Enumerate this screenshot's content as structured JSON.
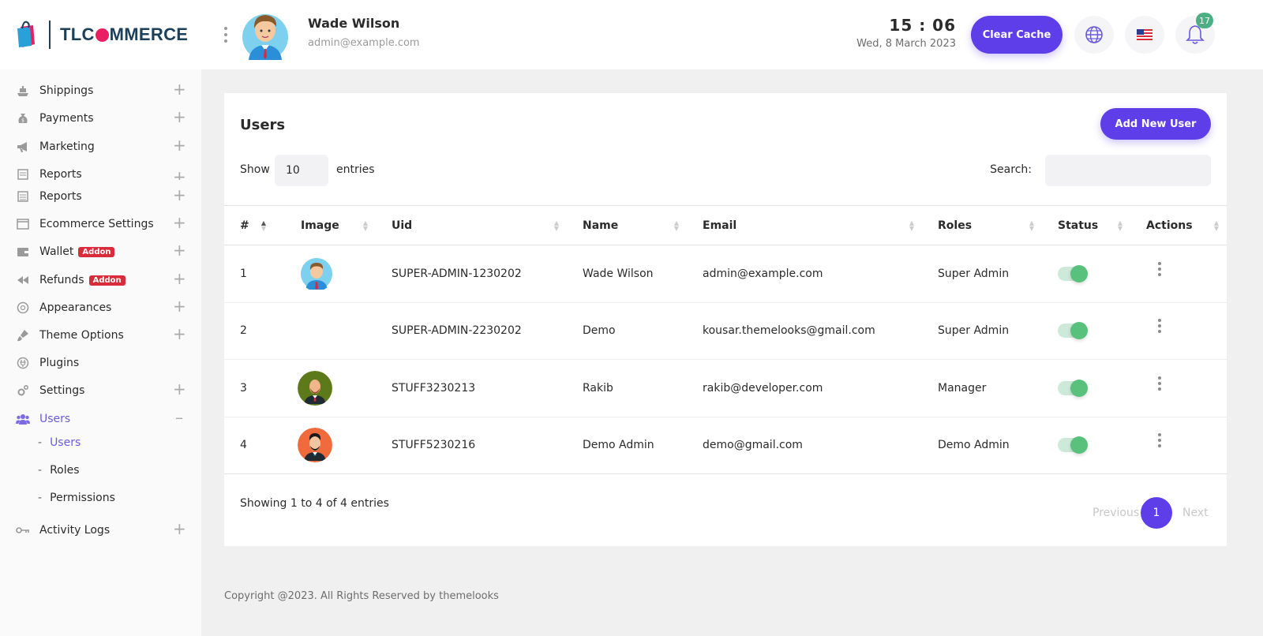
{
  "brand": {
    "name_pre": "TLC",
    "name_post": "MMERCE"
  },
  "header": {
    "user_name": "Wade Wilson",
    "user_email": "admin@example.com",
    "time": "15 : 06",
    "date": "Wed, 8 March 2023",
    "clear_cache_label": "Clear Cache",
    "notification_count": "17"
  },
  "sidebar": {
    "items": [
      {
        "label": "Shippings",
        "icon": "ship-icon"
      },
      {
        "label": "Payments",
        "icon": "money-bag-icon"
      },
      {
        "label": "Marketing",
        "icon": "megaphone-icon"
      },
      {
        "label": "Reports",
        "icon": "report-icon"
      },
      {
        "label": "Reports",
        "icon": "report-icon"
      },
      {
        "label": "Ecommerce Settings",
        "icon": "window-icon"
      },
      {
        "label": "Wallet",
        "icon": "wallet-icon",
        "badge": "Addon"
      },
      {
        "label": "Refunds",
        "icon": "rewind-icon",
        "badge": "Addon"
      },
      {
        "label": "Appearances",
        "icon": "palette-icon"
      },
      {
        "label": "Theme Options",
        "icon": "brush-icon"
      },
      {
        "label": "Plugins",
        "icon": "plug-icon"
      },
      {
        "label": "Settings",
        "icon": "gears-icon"
      },
      {
        "label": "Users",
        "icon": "users-icon"
      }
    ],
    "submenu": [
      {
        "label": "Users"
      },
      {
        "label": "Roles"
      },
      {
        "label": "Permissions"
      }
    ],
    "activity_logs": "Activity Logs"
  },
  "main": {
    "title": "Users",
    "add_button": "Add New User",
    "show_label": "Show",
    "entries_value": "10",
    "entries_label": "entries",
    "search_label": "Search:",
    "columns": [
      "#",
      "Image",
      "Uid",
      "Name",
      "Email",
      "Roles",
      "Status",
      "Actions"
    ],
    "rows": [
      {
        "num": "1",
        "uid": "SUPER-ADMIN-1230202",
        "name": "Wade Wilson",
        "email": "admin@example.com",
        "role": "Super Admin",
        "avatar": "blue"
      },
      {
        "num": "2",
        "uid": "SUPER-ADMIN-2230202",
        "name": "Demo",
        "email": "kousar.themelooks@gmail.com",
        "role": "Super Admin",
        "avatar": "none"
      },
      {
        "num": "3",
        "uid": "STUFF3230213",
        "name": "Rakib",
        "email": "rakib@developer.com",
        "role": "Manager",
        "avatar": "green"
      },
      {
        "num": "4",
        "uid": "STUFF5230216",
        "name": "Demo Admin",
        "email": "demo@gmail.com",
        "role": "Demo Admin",
        "avatar": "orange"
      }
    ],
    "showing_text": "Showing 1 to 4 of 4 entries",
    "pager": {
      "prev": "Previous",
      "page": "1",
      "next": "Next"
    }
  },
  "footer": {
    "text": "Copyright @2023. All Rights Reserved by themelooks"
  },
  "colors": {
    "accent": "#5e3ee8",
    "addon": "#d92b3a",
    "toggle_on": "#58c27d",
    "badge": "#4caf82"
  }
}
